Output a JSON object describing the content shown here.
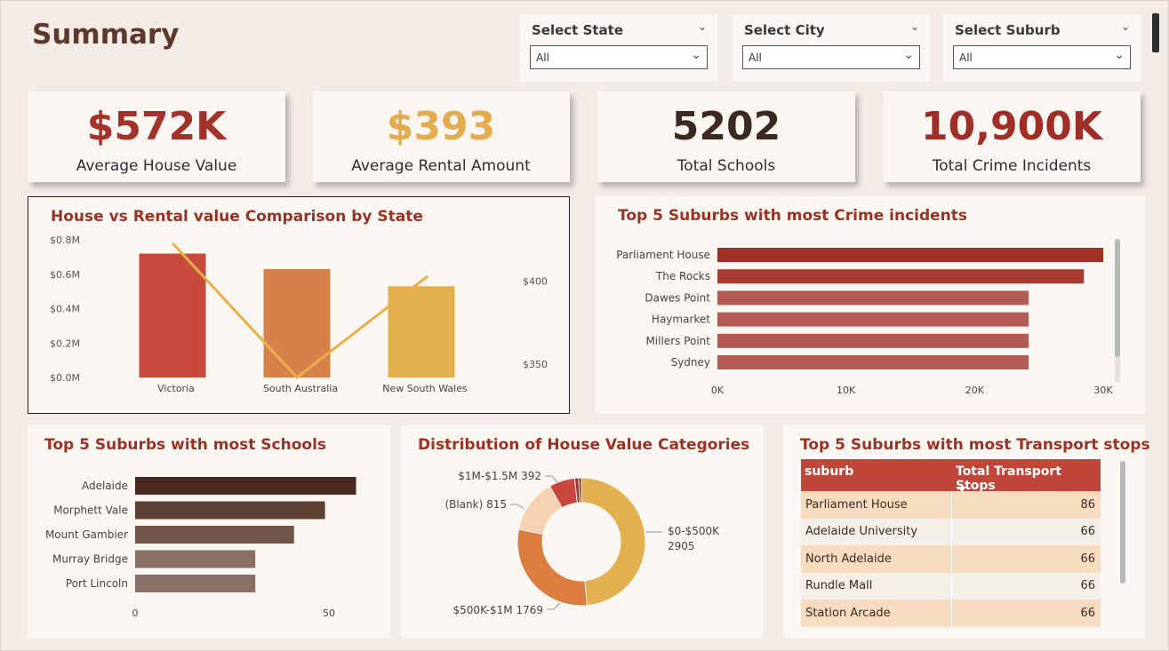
{
  "page": {
    "title": "Summary"
  },
  "slicers": [
    {
      "label": "Select State",
      "value": "All"
    },
    {
      "label": "Select City",
      "value": "All"
    },
    {
      "label": "Select Suburb",
      "value": "All"
    }
  ],
  "kpis": [
    {
      "value": "$572K",
      "label": "Average House Value",
      "color": "#a3322a"
    },
    {
      "value": "$393",
      "label": "Average Rental Amount",
      "color": "#e3ad4f"
    },
    {
      "value": "5202",
      "label": "Total Schools",
      "color": "#3a2a22"
    },
    {
      "value": "10,900K",
      "label": "Total Crime Incidents",
      "color": "#9f2e26"
    }
  ],
  "chart_data": [
    {
      "id": "house-vs-rental",
      "type": "bar",
      "title": "House vs Rental value Comparison by State",
      "categories": [
        "Victoria",
        "South Australia",
        "New South Wales"
      ],
      "series": [
        {
          "values": [
            0.72,
            0.63,
            0.53
          ],
          "colors": [
            "#c74a3c",
            "#d6804a",
            "#e3b04f"
          ]
        },
        {
          "values": [
            423,
            342,
            403
          ],
          "color": "#e8b04a",
          "render": "line"
        }
      ],
      "y_ticks": [
        "$0.0M",
        "$0.2M",
        "$0.4M",
        "$0.6M",
        "$0.8M"
      ],
      "ylim": [
        0,
        0.8
      ],
      "y2_ticks": [
        "$350",
        "$400"
      ],
      "y2_tick_values": [
        350,
        400
      ],
      "y2lim": [
        342,
        425
      ]
    },
    {
      "id": "crime-suburbs",
      "type": "bar",
      "orientation": "horizontal",
      "title": "Top 5 Suburbs with most Crime incidents",
      "categories": [
        "Parliament House",
        "The Rocks",
        "Dawes Point",
        "Haymarket",
        "Millers Point",
        "Sydney"
      ],
      "values": [
        30000,
        28500,
        24200,
        24200,
        24200,
        24200
      ],
      "colors": [
        "#a02f25",
        "#a73a30",
        "#b55a52",
        "#b55a52",
        "#b55a52",
        "#b55a52"
      ],
      "x_ticks": [
        "0K",
        "10K",
        "20K",
        "30K"
      ],
      "x_tick_values": [
        0,
        10000,
        20000,
        30000
      ],
      "xlim": [
        0,
        30000
      ]
    },
    {
      "id": "school-suburbs",
      "type": "bar",
      "orientation": "horizontal",
      "title": "Top 5 Suburbs with most Schools",
      "categories": [
        "Adelaide",
        "Morphett Vale",
        "Mount Gambier",
        "Murray Bridge",
        "Port Lincoln"
      ],
      "values": [
        57,
        49,
        41,
        31,
        31
      ],
      "colors": [
        "#4a2a1e",
        "#5e3f33",
        "#725549",
        "#8a7064",
        "#8a7064"
      ],
      "x_ticks": [
        "0",
        "50"
      ],
      "x_tick_values": [
        0,
        50
      ],
      "xlim": [
        0,
        50
      ]
    },
    {
      "id": "house-value-dist",
      "type": "pie",
      "title": "Distribution of House Value Categories",
      "labels": [
        "$0-$500K",
        "$500K-$1M",
        "(Blank)",
        "$1M-$1.5M",
        "",
        ""
      ],
      "values": [
        2905,
        1769,
        815,
        392,
        60,
        40
      ],
      "display": [
        "2905",
        "1769",
        "815",
        "392",
        "",
        ""
      ],
      "colors": [
        "#e3b04f",
        "#db7e3e",
        "#f6d2b1",
        "#c9473c",
        "#9b2f26",
        "#5b2a20"
      ]
    }
  ],
  "transport_table": {
    "title": "Top 5 Suburbs with most Transport stops",
    "columns": [
      "suburb",
      "Total Transport Stops"
    ],
    "rows": [
      [
        "Parliament House",
        "86"
      ],
      [
        "Adelaide University",
        "66"
      ],
      [
        "North Adelaide",
        "66"
      ],
      [
        "Rundle Mall",
        "66"
      ],
      [
        "Station Arcade",
        "66"
      ]
    ]
  }
}
